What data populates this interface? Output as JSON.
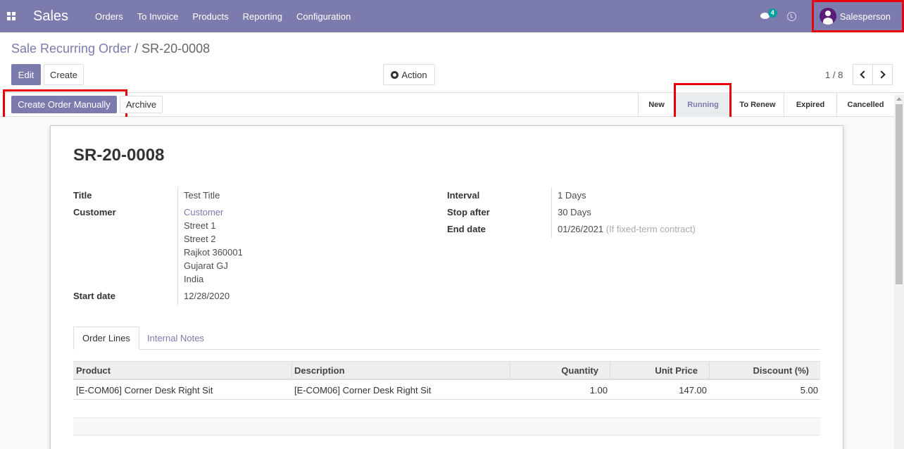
{
  "navbar": {
    "brand": "Sales",
    "menu": [
      "Orders",
      "To Invoice",
      "Products",
      "Reporting",
      "Configuration"
    ],
    "chat_count": "4",
    "user": "Salesperson"
  },
  "breadcrumb": {
    "parent": "Sale Recurring Order",
    "separator": "/",
    "current": "SR-20-0008"
  },
  "toolbar": {
    "edit": "Edit",
    "create": "Create",
    "action": "Action",
    "pager": "1 / 8"
  },
  "statusbar": {
    "create_manual": "Create Order Manually",
    "archive": "Archive",
    "stages": [
      "New",
      "Running",
      "To Renew",
      "Expired",
      "Cancelled"
    ],
    "active_stage": "Running"
  },
  "form": {
    "name": "SR-20-0008",
    "title_label": "Title",
    "title_value": "Test Title",
    "customer_label": "Customer",
    "customer_name": "Customer",
    "address": [
      "Street 1",
      "Street 2",
      "Rajkot 360001",
      "Gujarat GJ",
      "India"
    ],
    "start_date_label": "Start date",
    "start_date": "12/28/2020",
    "interval_label": "Interval",
    "interval_value": "1",
    "interval_unit": "Days",
    "stop_after_label": "Stop after",
    "stop_after_value": "30",
    "stop_after_unit": "Days",
    "end_date_label": "End date",
    "end_date": "01/26/2021",
    "end_date_hint": "(If fixed-term contract)"
  },
  "tabs": [
    "Order Lines",
    "Internal Notes"
  ],
  "order_lines": {
    "columns": [
      "Product",
      "Description",
      "Quantity",
      "Unit Price",
      "Discount (%)"
    ],
    "rows": [
      {
        "product": "[E-COM06] Corner Desk Right Sit",
        "description": "[E-COM06] Corner Desk Right Sit",
        "quantity": "1.00",
        "unit_price": "147.00",
        "discount": "5.00"
      }
    ]
  }
}
